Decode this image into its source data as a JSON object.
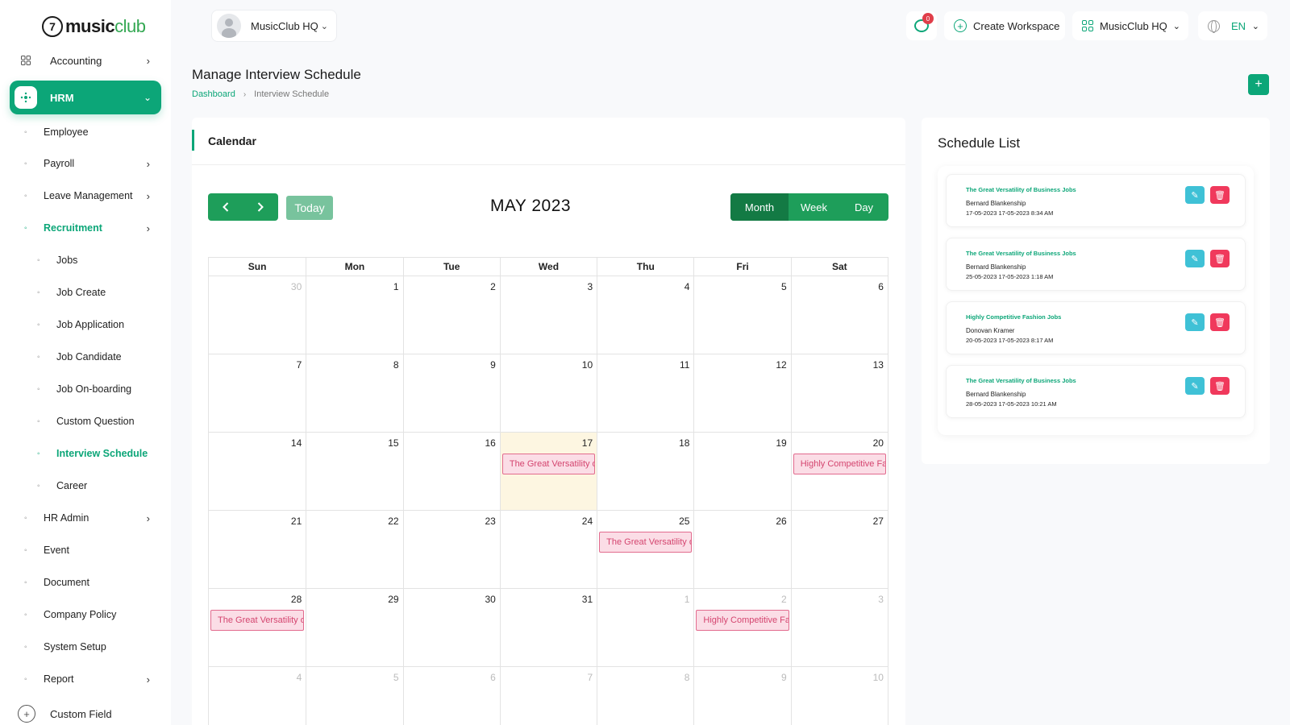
{
  "brand": {
    "logo_mark": "7",
    "bold": "music",
    "light": "club"
  },
  "workspace_select": {
    "label": "MusicClub HQ",
    "chevron": "⌄"
  },
  "topbar": {
    "messages_badge": "0",
    "create_workspace": "Create Workspace",
    "workspace": "MusicClub HQ",
    "language": "EN"
  },
  "sidebar": {
    "accounting": "Accounting",
    "hrm": "HRM",
    "items": [
      {
        "label": "Employee",
        "has_chevron": false
      },
      {
        "label": "Payroll",
        "has_chevron": true
      },
      {
        "label": "Leave Management",
        "has_chevron": true
      },
      {
        "label": "Recruitment",
        "has_chevron": true,
        "active": true
      }
    ],
    "recruitment_sub": [
      "Jobs",
      "Job Create",
      "Job Application",
      "Job Candidate",
      "Job On-boarding",
      "Custom Question",
      "Interview Schedule",
      "Career"
    ],
    "active_sub": "Interview Schedule",
    "items_after": [
      {
        "label": "HR Admin",
        "has_chevron": true
      },
      {
        "label": "Event",
        "has_chevron": false
      },
      {
        "label": "Document",
        "has_chevron": false
      },
      {
        "label": "Company Policy",
        "has_chevron": false
      },
      {
        "label": "System Setup",
        "has_chevron": false
      },
      {
        "label": "Report",
        "has_chevron": true
      }
    ],
    "custom_field": "Custom Field"
  },
  "page": {
    "title": "Manage Interview Schedule",
    "breadcrumb": [
      "Dashboard",
      "Interview Schedule"
    ],
    "add_button": "+"
  },
  "calendar": {
    "card_title": "Calendar",
    "month_title": "MAY 2023",
    "today_label": "Today",
    "views": [
      "Month",
      "Week",
      "Day"
    ],
    "active_view": "Month",
    "weekdays": [
      "Sun",
      "Mon",
      "Tue",
      "Wed",
      "Thu",
      "Fri",
      "Sat"
    ],
    "weeks": [
      [
        {
          "d": "30",
          "o": true
        },
        {
          "d": "1"
        },
        {
          "d": "2"
        },
        {
          "d": "3"
        },
        {
          "d": "4"
        },
        {
          "d": "5"
        },
        {
          "d": "6"
        }
      ],
      [
        {
          "d": "7"
        },
        {
          "d": "8"
        },
        {
          "d": "9"
        },
        {
          "d": "10"
        },
        {
          "d": "11"
        },
        {
          "d": "12"
        },
        {
          "d": "13"
        }
      ],
      [
        {
          "d": "14"
        },
        {
          "d": "15"
        },
        {
          "d": "16"
        },
        {
          "d": "17",
          "today": true,
          "event": "The Great Versatility of Business Jobs"
        },
        {
          "d": "18"
        },
        {
          "d": "19"
        },
        {
          "d": "20",
          "event": "Highly Competitive Fashion Jobs"
        }
      ],
      [
        {
          "d": "21"
        },
        {
          "d": "22"
        },
        {
          "d": "23"
        },
        {
          "d": "24"
        },
        {
          "d": "25",
          "event": "The Great Versatility of Business Jobs"
        },
        {
          "d": "26"
        },
        {
          "d": "27"
        }
      ],
      [
        {
          "d": "28",
          "event": "The Great Versatility of Business Jobs"
        },
        {
          "d": "29"
        },
        {
          "d": "30"
        },
        {
          "d": "31"
        },
        {
          "d": "1",
          "o": true
        },
        {
          "d": "2",
          "o": true,
          "event": "Highly Competitive Fashion Jobs"
        },
        {
          "d": "3",
          "o": true
        }
      ],
      [
        {
          "d": "4",
          "o": true
        },
        {
          "d": "5",
          "o": true
        },
        {
          "d": "6",
          "o": true
        },
        {
          "d": "7",
          "o": true
        },
        {
          "d": "8",
          "o": true
        },
        {
          "d": "9",
          "o": true
        },
        {
          "d": "10",
          "o": true
        }
      ]
    ]
  },
  "schedule_list": {
    "title": "Schedule List",
    "items": [
      {
        "job": "The Great Versatility of Business Jobs",
        "person": "Bernard Blankenship",
        "dates": "17-05-2023 17-05-2023 8:34 AM"
      },
      {
        "job": "The Great Versatility of Business Jobs",
        "person": "Bernard Blankenship",
        "dates": "25-05-2023 17-05-2023 1:18 AM"
      },
      {
        "job": "Highly Competitive Fashion Jobs",
        "person": "Donovan Kramer",
        "dates": "20-05-2023 17-05-2023 8:17 AM"
      },
      {
        "job": "The Great Versatility of Business Jobs",
        "person": "Bernard Blankenship",
        "dates": "28-05-2023 17-05-2023 10:21 AM"
      }
    ]
  }
}
